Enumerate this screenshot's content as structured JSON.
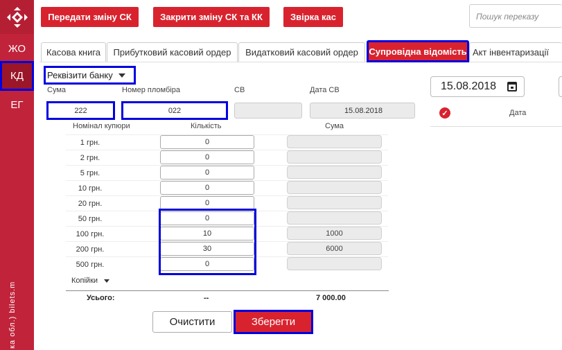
{
  "sidebar": {
    "items": [
      {
        "label": "ЖО",
        "active": false
      },
      {
        "label": "КД",
        "active": true
      },
      {
        "label": "ЕГ",
        "active": false
      }
    ],
    "vertical_text": "ка обл.) bilets.m"
  },
  "toolbar": {
    "btn_shift_transfer": "Передати зміну СК",
    "btn_close_shift": "Закрити зміну СК та КК",
    "btn_reconcile": "Звірка кас",
    "search_placeholder": "Пошук переказу"
  },
  "tabs": [
    {
      "label": "Касова книга",
      "active": false
    },
    {
      "label": "Прибутковий касовий ордер",
      "active": false
    },
    {
      "label": "Видатковий касовий ордер",
      "active": false
    },
    {
      "label": "Супровідна відомість",
      "active": true
    },
    {
      "label": "Акт інвентаризації",
      "active": false
    }
  ],
  "form": {
    "bank_details_label": "Реквізити банку",
    "sum_label": "Сума",
    "sum_value": "222",
    "seal_label": "Номер пломбіра",
    "seal_value": "022",
    "sv_label": "СВ",
    "sv_value": "",
    "sv_date_label": "Дата СВ",
    "sv_date_value": "15.08.2018",
    "col_denomination": "Номінал купюри",
    "col_quantity": "Кількість",
    "col_sum": "Сума",
    "rows": [
      {
        "denom": "1 грн.",
        "qty": "0",
        "sum": ""
      },
      {
        "denom": "2 грн.",
        "qty": "0",
        "sum": ""
      },
      {
        "denom": "5 грн.",
        "qty": "0",
        "sum": ""
      },
      {
        "denom": "10 грн.",
        "qty": "0",
        "sum": ""
      },
      {
        "denom": "20 грн.",
        "qty": "0",
        "sum": ""
      },
      {
        "denom": "50 грн.",
        "qty": "0",
        "sum": ""
      },
      {
        "denom": "100 грн.",
        "qty": "10",
        "sum": "1000"
      },
      {
        "denom": "200 грн.",
        "qty": "30",
        "sum": "6000"
      },
      {
        "denom": "500 грн.",
        "qty": "0",
        "sum": ""
      }
    ],
    "coins_label": "Копійки",
    "total_label": "Усього:",
    "total_qty": "--",
    "total_sum": "7 000.00",
    "btn_clear": "Очистити",
    "btn_save": "Зберегти"
  },
  "right_panel": {
    "date": "15.08.2018",
    "col_date": "Дата"
  },
  "colors": {
    "brand_red": "#d8232f",
    "sidebar_red": "#c0233a",
    "highlight_blue": "#0000e0"
  }
}
